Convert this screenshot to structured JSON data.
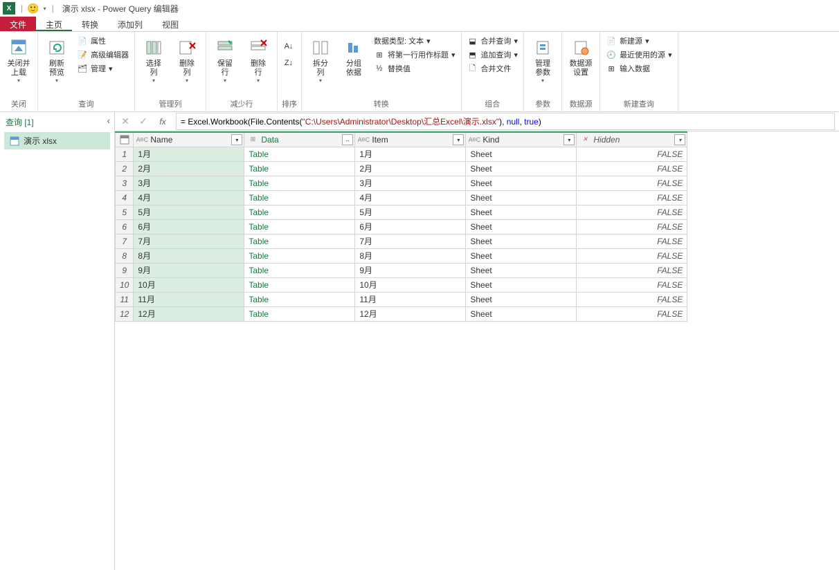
{
  "title": "演示 xlsx - Power Query 编辑器",
  "tabs": {
    "file": "文件",
    "home": "主页",
    "transform": "转换",
    "addcol": "添加列",
    "view": "视图"
  },
  "ribbon": {
    "close": {
      "big": "关闭并\n上载",
      "label": "关闭"
    },
    "query": {
      "refresh": "刷新\n预览",
      "props": "属性",
      "adv": "高级编辑器",
      "manage": "管理",
      "label": "查询"
    },
    "cols": {
      "choose": "选择\n列",
      "remove": "删除\n列",
      "label": "管理列"
    },
    "rows": {
      "keep": "保留\n行",
      "remove": "删除\n行",
      "label": "减少行"
    },
    "sort": {
      "label": "排序"
    },
    "trans": {
      "split": "拆分\n列",
      "group": "分组\n依据",
      "dtype": "数据类型: 文本",
      "firstrow": "将第一行用作标题",
      "replace": "替换值",
      "label": "转换"
    },
    "combine": {
      "merge": "合并查询",
      "append": "追加查询",
      "files": "合并文件",
      "label": "组合"
    },
    "params": {
      "manage": "管理\n参数",
      "label": "参数"
    },
    "ds": {
      "settings": "数据源\n设置",
      "label": "数据源"
    },
    "newq": {
      "new": "新建源",
      "recent": "最近使用的源",
      "enter": "输入数据",
      "label": "新建查询"
    }
  },
  "sidebar": {
    "header": "查询 [1]",
    "item": "演示 xlsx"
  },
  "formula": {
    "prefix": "= Excel.Workbook(File.Contents(",
    "path": "\"C:\\Users\\Administrator\\Desktop\\汇总Excel\\演示.xlsx\"",
    "mid": "), ",
    "null": "null",
    "comma": ", ",
    "true": "true",
    "end": ")"
  },
  "columns": {
    "name": "Name",
    "data": "Data",
    "item": "Item",
    "kind": "Kind",
    "hidden": "Hidden"
  },
  "rows": [
    {
      "n": "1",
      "name": "1月",
      "data": "Table",
      "item": "1月",
      "kind": "Sheet",
      "hidden": "FALSE"
    },
    {
      "n": "2",
      "name": "2月",
      "data": "Table",
      "item": "2月",
      "kind": "Sheet",
      "hidden": "FALSE"
    },
    {
      "n": "3",
      "name": "3月",
      "data": "Table",
      "item": "3月",
      "kind": "Sheet",
      "hidden": "FALSE"
    },
    {
      "n": "4",
      "name": "4月",
      "data": "Table",
      "item": "4月",
      "kind": "Sheet",
      "hidden": "FALSE"
    },
    {
      "n": "5",
      "name": "5月",
      "data": "Table",
      "item": "5月",
      "kind": "Sheet",
      "hidden": "FALSE"
    },
    {
      "n": "6",
      "name": "6月",
      "data": "Table",
      "item": "6月",
      "kind": "Sheet",
      "hidden": "FALSE"
    },
    {
      "n": "7",
      "name": "7月",
      "data": "Table",
      "item": "7月",
      "kind": "Sheet",
      "hidden": "FALSE"
    },
    {
      "n": "8",
      "name": "8月",
      "data": "Table",
      "item": "8月",
      "kind": "Sheet",
      "hidden": "FALSE"
    },
    {
      "n": "9",
      "name": "9月",
      "data": "Table",
      "item": "9月",
      "kind": "Sheet",
      "hidden": "FALSE"
    },
    {
      "n": "10",
      "name": "10月",
      "data": "Table",
      "item": "10月",
      "kind": "Sheet",
      "hidden": "FALSE"
    },
    {
      "n": "11",
      "name": "11月",
      "data": "Table",
      "item": "11月",
      "kind": "Sheet",
      "hidden": "FALSE"
    },
    {
      "n": "12",
      "name": "12月",
      "data": "Table",
      "item": "12月",
      "kind": "Sheet",
      "hidden": "FALSE"
    }
  ]
}
